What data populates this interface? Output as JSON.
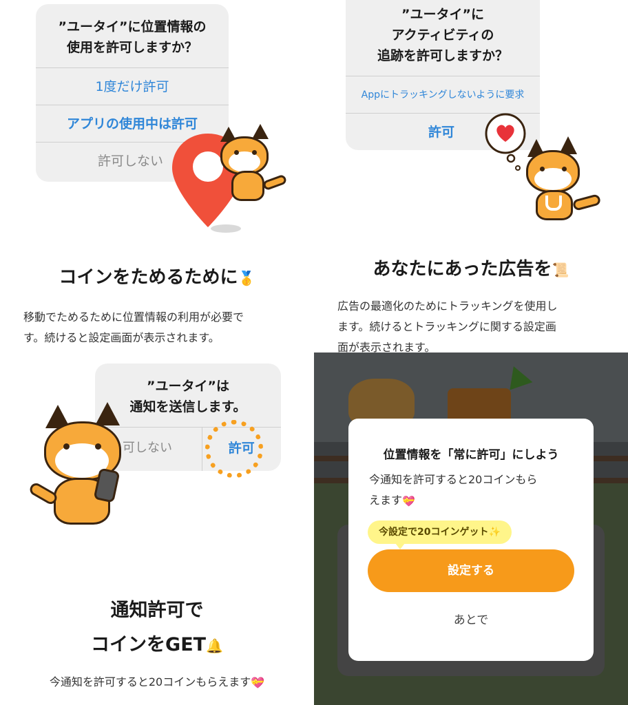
{
  "panel_location": {
    "alert_title_line1": "”ユータイ”に位置情報の",
    "alert_title_line2": "使用を許可しますか？",
    "option_once": "1度だけ許可",
    "option_while_using": "アプリの使用中は許可",
    "option_deny": "許可しない",
    "heading": "コインをためるために",
    "heading_emoji": "🥇",
    "body_line1": "移動でためるために位置情報の利用が必要で",
    "body_line2": "す。続けると設定画面が表示されます。"
  },
  "panel_tracking": {
    "alert_title_line1": "”ユータイ”に",
    "alert_title_line2": "アクティビティの",
    "alert_title_line3": "追跡を許可しますか？",
    "option_ask_not_track": "Appにトラッキングしないように要求",
    "option_allow": "許可",
    "heading": "あなたにあった広告を",
    "heading_emoji": "📜",
    "body_line1": "広告の最適化のためにトラッキングを使用し",
    "body_line2": "ます。続けるとトラッキングに関する設定画",
    "body_line3": "面が表示されます。"
  },
  "panel_notification": {
    "alert_title_line1": "”ユータイ”は",
    "alert_title_line2": "通知を送信します。",
    "option_deny_partial": "可しない",
    "option_allow": "許可",
    "heading_line1": "通知許可で",
    "heading_line2": "コインをGET",
    "heading_emoji": "🔔",
    "body": "今通知を許可すると20コインもらえます",
    "body_emoji": "💝"
  },
  "panel_modal": {
    "title": "位置情報を「常に許可」にしよう",
    "message_line1": "今通知を許可すると20コインもら",
    "message_line2": "えます",
    "message_emoji": "💝",
    "tooltip": "今設定で20コインゲット",
    "tooltip_emoji": "✨",
    "primary_button": "設定する",
    "secondary_button": "あとで"
  },
  "colors": {
    "ios_blue": "#2f86d8",
    "alert_bg": "#efefef",
    "pin_red": "#f0503a",
    "dog_orange": "#f7a93a",
    "cta_orange": "#f79a1a",
    "tooltip_yellow": "#fff58a",
    "overlay_dark": "#3a3d3f"
  }
}
